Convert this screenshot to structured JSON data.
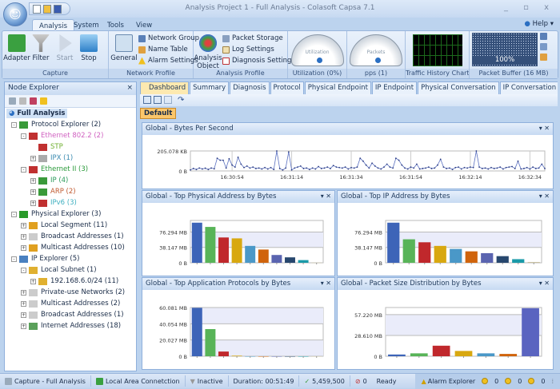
{
  "window": {
    "title": "Analysis Project 1 - Full Analysis -  Colasoft Capsa 7.1",
    "controls": "_ ▫ x"
  },
  "ribbon_tabs": [
    "Analysis",
    "System",
    "Tools",
    "View"
  ],
  "help": "Help",
  "ribbon": {
    "capture": {
      "label": "Capture",
      "buttons": [
        "Adapter",
        "Filter",
        "Start",
        "Stop"
      ]
    },
    "network_profile": {
      "label": "Network Profile",
      "general": "General",
      "items": [
        "Network Group",
        "Name Table",
        "Alarm Settings"
      ]
    },
    "analysis_profile": {
      "label": "Analysis Profile",
      "object": "Analysis Object",
      "items": [
        "Packet Storage",
        "Log Settings",
        "Diagnosis Settings"
      ]
    },
    "utilization": {
      "label": "Utilization (0%)",
      "gauge_text": "Utilization",
      "value": 0
    },
    "pps": {
      "label": "pps (1)",
      "gauge_text": "Packets",
      "value": 1
    },
    "traffic": {
      "label": "Traffic History Chart(..."
    },
    "buffer": {
      "label": "Packet Buffer (16 MB)",
      "percent_text": "100%",
      "fill": 1.0
    }
  },
  "node_explorer": {
    "title": "Node Explorer",
    "close": "×",
    "root": "Full Analysis",
    "items": [
      {
        "label": "Protocol Explorer (2)",
        "level": 0,
        "exp": "-",
        "color": "#1a2c48",
        "icon": "#3a9a3a"
      },
      {
        "label": "Ethernet 802.2 (2)",
        "level": 1,
        "exp": "-",
        "color": "#d060c0",
        "icon": "#c03030"
      },
      {
        "label": "STP",
        "level": 2,
        "exp": "",
        "color": "#70b030",
        "icon": "#c03030"
      },
      {
        "label": "IPX (1)",
        "level": 2,
        "exp": "+",
        "color": "#3a8ab0",
        "icon": "#aaaaaa"
      },
      {
        "label": "Ethernet II (3)",
        "level": 1,
        "exp": "-",
        "color": "#2a9a3a",
        "icon": "#c03030"
      },
      {
        "label": "IP (4)",
        "level": 2,
        "exp": "+",
        "color": "#2a9a5a",
        "icon": "#3a9a3a"
      },
      {
        "label": "ARP (2)",
        "level": 2,
        "exp": "+",
        "color": "#c05a30",
        "icon": "#3a9a3a"
      },
      {
        "label": "IPv6 (3)",
        "level": 2,
        "exp": "+",
        "color": "#40b0c0",
        "icon": "#c03030"
      },
      {
        "label": "Physical Explorer (3)",
        "level": 0,
        "exp": "-",
        "color": "#1a2c48",
        "icon": "#2a9a2a"
      },
      {
        "label": "Local Segment (11)",
        "level": 1,
        "exp": "+",
        "color": "#1a2c48",
        "icon": "#e0a020"
      },
      {
        "label": "Broadcast Addresses (1)",
        "level": 1,
        "exp": "+",
        "color": "#1a2c48",
        "icon": "#cccccc"
      },
      {
        "label": "Multicast Addresses (10)",
        "level": 1,
        "exp": "+",
        "color": "#1a2c48",
        "icon": "#e0a020"
      },
      {
        "label": "IP Explorer (5)",
        "level": 0,
        "exp": "-",
        "color": "#1a2c48",
        "icon": "#4a80c0"
      },
      {
        "label": "Local Subnet (1)",
        "level": 1,
        "exp": "-",
        "color": "#1a2c48",
        "icon": "#e0b030"
      },
      {
        "label": "192.168.6.0/24 (11)",
        "level": 2,
        "exp": "+",
        "color": "#1a2c48",
        "icon": "#e0b030"
      },
      {
        "label": "Private-use Networks (2)",
        "level": 1,
        "exp": "+",
        "color": "#1a2c48",
        "icon": "#cccccc"
      },
      {
        "label": "Multicast Addresses (2)",
        "level": 1,
        "exp": "+",
        "color": "#1a2c48",
        "icon": "#cccccc"
      },
      {
        "label": "Broadcast Addresses (1)",
        "level": 1,
        "exp": "+",
        "color": "#1a2c48",
        "icon": "#cccccc"
      },
      {
        "label": "Internet Addresses (18)",
        "level": 1,
        "exp": "+",
        "color": "#1a2c48",
        "icon": "#5aa05a"
      }
    ]
  },
  "doc_tabs": [
    "Dashboard",
    "Summary",
    "Diagnosis",
    "Protocol",
    "Physical Endpoint",
    "IP Endpoint",
    "Physical Conversation",
    "IP Conversation",
    "TCP"
  ],
  "default_tab": "Default",
  "bar_colors": [
    "#3d64b8",
    "#58b458",
    "#c0282c",
    "#d8a810",
    "#4a98c8",
    "#d0640c",
    "#5a64b0",
    "#27476e",
    "#1a9aa8",
    "#c8c0a0"
  ],
  "chart_data": [
    {
      "type": "line",
      "title": "Global - Bytes Per Second",
      "ylabel_ticks": [
        "205.078 KB",
        "0  B"
      ],
      "ylim": [
        0,
        205.078
      ],
      "unit": "KB",
      "x_ticks": [
        "16:30:54",
        "16:31:14",
        "16:31:34",
        "16:31:54",
        "16:32:14",
        "16:32:34"
      ],
      "values": [
        10,
        25,
        15,
        30,
        20,
        28,
        15,
        30,
        22,
        130,
        110,
        110,
        30,
        125,
        60,
        40,
        140,
        70,
        35,
        50,
        30,
        40,
        25,
        30,
        20,
        35,
        20,
        35,
        15,
        205,
        25,
        10,
        30,
        195,
        10,
        30,
        40,
        50,
        25,
        30,
        15,
        30,
        20,
        45,
        25,
        30,
        40,
        25,
        55,
        40,
        35,
        30,
        40,
        20,
        35,
        30,
        40,
        130,
        100,
        60,
        30,
        80,
        50,
        30,
        20,
        40,
        70,
        40,
        30,
        130,
        110,
        60,
        30,
        20,
        40,
        30,
        70,
        20,
        25,
        30,
        40,
        25,
        30,
        60,
        120,
        40,
        25,
        30,
        15,
        35,
        40,
        20,
        35,
        30,
        40,
        35,
        205,
        40,
        25,
        30,
        20,
        35,
        25,
        30,
        40,
        20,
        35,
        40,
        45,
        25,
        100,
        20,
        25,
        35,
        20,
        40,
        25,
        30,
        70,
        25
      ]
    },
    {
      "type": "bar",
      "title": "Global - Top Physical Address by Bytes",
      "ylabel_ticks": [
        "76.294 MB",
        "38.147 MB",
        "0  B"
      ],
      "tick_values": [
        76.294,
        38.147,
        0
      ],
      "ylim": [
        0,
        105
      ],
      "unit": "MB",
      "values": [
        99.5,
        89,
        62.8,
        60.6,
        41.9,
        32.9,
        19.4,
        13.5,
        6.7,
        0.5
      ]
    },
    {
      "type": "bar",
      "title": "Global - Top IP Address by Bytes",
      "ylabel_ticks": [
        "76.294 MB",
        "38.147 MB",
        "0  B"
      ],
      "tick_values": [
        76.294,
        38.147,
        0
      ],
      "ylim": [
        0,
        105
      ],
      "unit": "MB",
      "values": [
        99.5,
        58.3,
        50.9,
        41.9,
        34.4,
        28.4,
        23.9,
        16.5,
        9,
        2
      ]
    },
    {
      "type": "bar",
      "title": "Global - Top Application Protocols by Bytes",
      "ylabel_ticks": [
        "60.081 MB",
        "40.054 MB",
        "20.027 MB",
        "0  B"
      ],
      "tick_values": [
        60.081,
        40.054,
        20.027,
        0
      ],
      "ylim": [
        0,
        60.081
      ],
      "unit": "MB",
      "values": [
        59.7,
        33.5,
        5.8,
        0.7,
        0,
        0,
        0,
        0,
        0,
        0
      ]
    },
    {
      "type": "bar",
      "title": "Global - Packet Size Distribution by Bytes",
      "ylabel_ticks": [
        "57.220 MB",
        "28.610 MB",
        "0  B"
      ],
      "tick_values": [
        57.22,
        28.61,
        0
      ],
      "ylim": [
        0,
        67
      ],
      "unit": "MB",
      "values": [
        2.4,
        4,
        14.5,
        7.3,
        4,
        3.2,
        66.1
      ],
      "colors": [
        "#3d64b8",
        "#58b458",
        "#c0282c",
        "#d8a810",
        "#4a98c8",
        "#d0640c",
        "#5a64c0"
      ]
    }
  ],
  "status": {
    "capture": "Capture - Full Analysis",
    "adapter": "Local Area Connetction",
    "filter": "Inactive",
    "duration": "Duration: 00:51:49",
    "packets": "5,459,500",
    "dropped": "0",
    "state": "Ready",
    "alarm": "Alarm Explorer",
    "alarm_counts": [
      "0",
      "0",
      "0"
    ]
  }
}
